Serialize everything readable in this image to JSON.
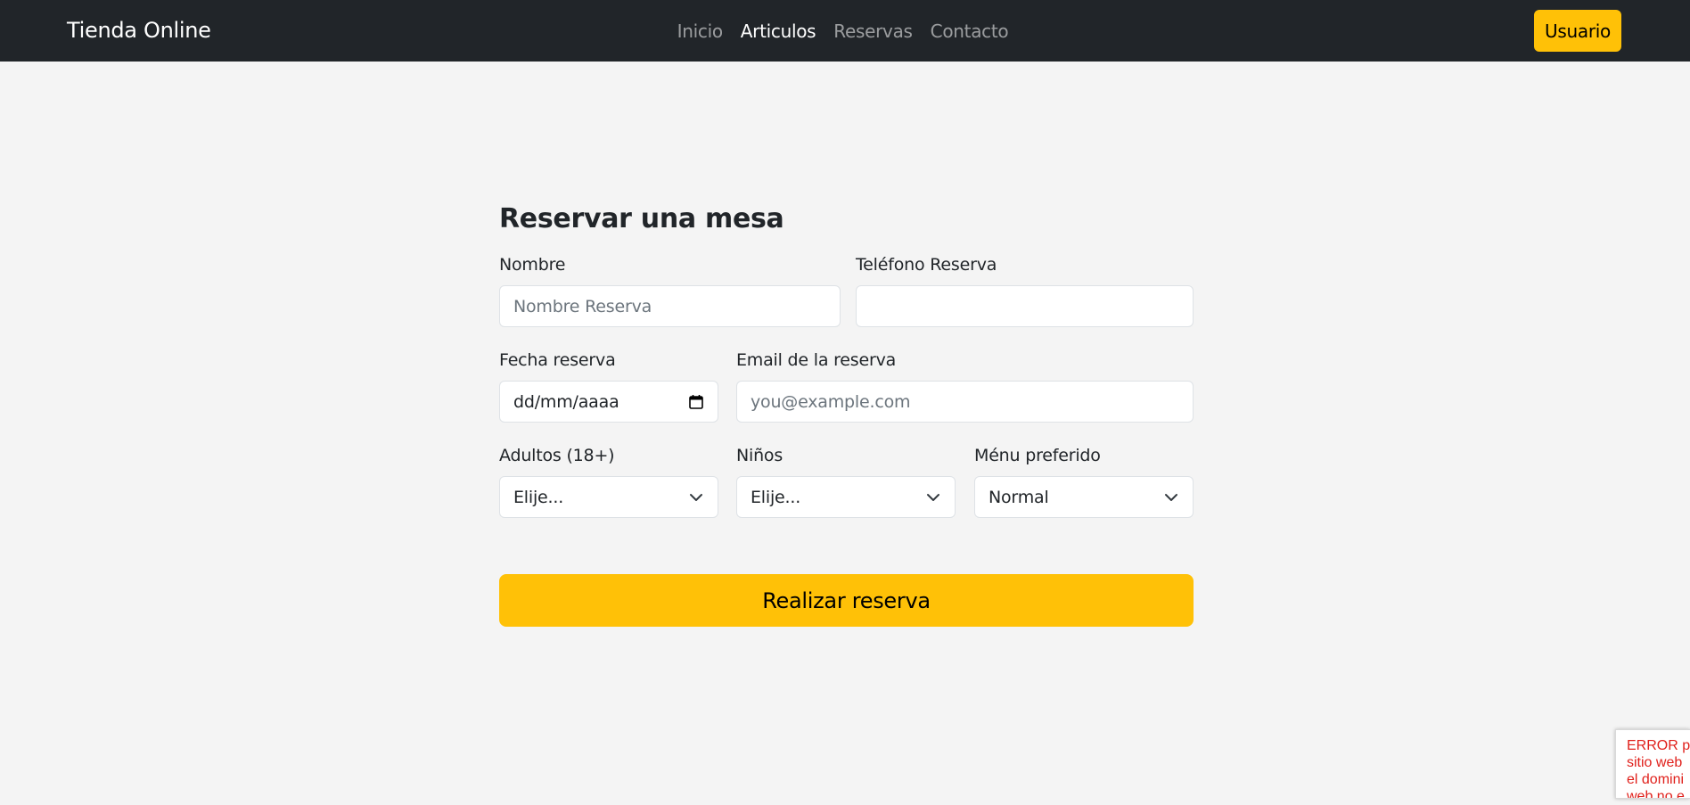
{
  "navbar": {
    "brand": "Tienda Online",
    "links": [
      {
        "label": "Inicio",
        "active": false
      },
      {
        "label": "Articulos",
        "active": true
      },
      {
        "label": "Reservas",
        "active": false
      },
      {
        "label": "Contacto",
        "active": false
      }
    ],
    "user_button": "Usuario"
  },
  "form": {
    "title": "Reservar una mesa",
    "nombre": {
      "label": "Nombre",
      "placeholder": "Nombre Reserva",
      "value": ""
    },
    "telefono": {
      "label": "Teléfono Reserva",
      "placeholder": "",
      "value": ""
    },
    "fecha": {
      "label": "Fecha reserva",
      "value": "dd/mm/aaaa"
    },
    "email": {
      "label": "Email de la reserva",
      "placeholder": "you@example.com",
      "value": ""
    },
    "adultos": {
      "label": "Adultos (18+)",
      "selected": "Elije..."
    },
    "ninos": {
      "label": "Niños",
      "selected": "Elije..."
    },
    "menu": {
      "label": "Ménu preferido",
      "selected": "Normal"
    },
    "submit_label": "Realizar reserva"
  },
  "error_notice": {
    "text": "ERROR pa\nsitio web\nel domini\nweb no e"
  },
  "colors": {
    "navbar_bg": "#212529",
    "accent": "#ffc107",
    "page_bg": "#f4f4f4",
    "error_text": "#e0201b"
  },
  "icons": {
    "select_arrow": "chevron-down-icon",
    "date_picker": "calendar-icon"
  }
}
